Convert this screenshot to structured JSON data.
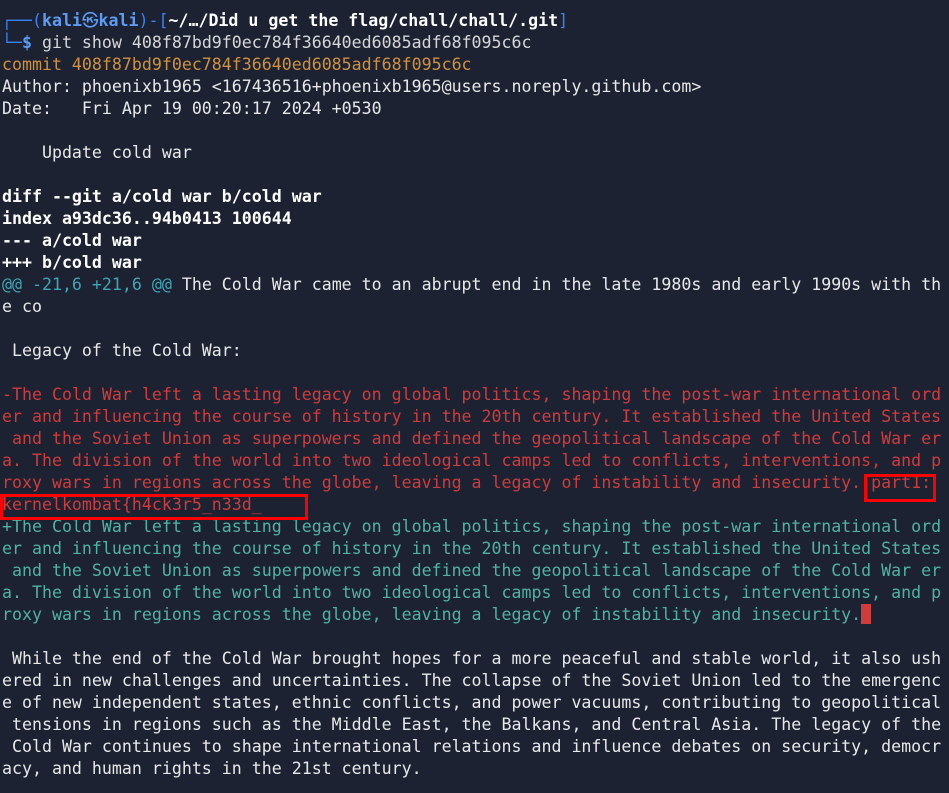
{
  "prompt": {
    "frame_open": "┌──(",
    "user": "kali",
    "at": "㉿",
    "host": "kali",
    "frame_mid": ")-[",
    "path": "~/…/Did u get the flag/chall/chall/.git",
    "frame_close": "]",
    "frame_bottom": "└─",
    "sigil": "$",
    "command": " git show 408f87bd9f0ec784f36640ed6085adf68f095c6c"
  },
  "commit": {
    "line": "commit 408f87bd9f0ec784f36640ed6085adf68f095c6c",
    "author": "Author: phoenixb1965 <167436516+phoenixb1965@users.noreply.github.com>",
    "date": "Date:   Fri Apr 19 00:20:17 2024 +0530",
    "message": "    Update cold war"
  },
  "diff": {
    "header": "diff --git a/cold war b/cold war",
    "index": "index a93dc36..94b0413 100644",
    "minus_file": "--- a/cold war",
    "plus_file": "+++ b/cold war",
    "hunk_marker": "@@ -21,6 +21,6 @@",
    "hunk_context_1": " The Cold War came to an abrupt end in the late 1980s and early 1990s with th",
    "hunk_context_2": "e co",
    "legacy_heading": " Legacy of the Cold War:",
    "removed_lines": [
      "-The Cold War left a lasting legacy on global politics, shaping the post-war international ord",
      "er and influencing the course of history in the 20th century. It established the United States",
      " and the Soviet Union as superpowers and defined the geopolitical landscape of the Cold War er",
      "a. The division of the world into two ideological camps led to conflicts, interventions, and p",
      "roxy wars in regions across the globe, leaving a legacy of instability and insecurity. part1:",
      "kernelkombat{h4ck3r5_n33d_"
    ],
    "added_lines": [
      "+The Cold War left a lasting legacy on global politics, shaping the post-war international ord",
      "er and influencing the course of history in the 20th century. It established the United States",
      " and the Soviet Union as superpowers and defined the geopolitical landscape of the Cold War er",
      "a. The division of the world into two ideological camps led to conflicts, interventions, and p",
      "roxy wars in regions across the globe, leaving a legacy of instability and insecurity."
    ],
    "context_lines": [
      " While the end of the Cold War brought hopes for a more peaceful and stable world, it also ush",
      "ered in new challenges and uncertainties. The collapse of the Soviet Union led to the emergenc",
      "e of new independent states, ethnic conflicts, and power vacuums, contributing to geopolitical",
      " tensions in regions such as the Middle East, the Balkans, and Central Asia. The legacy of the",
      " Cold War continues to shape international relations and influence debates on security, democr",
      "acy, and human rights in the 21st century."
    ]
  },
  "colors": {
    "background": "#1c2231",
    "prompt_blue": "#5c9cf5",
    "commit_orange": "#d1913c",
    "removed_red": "#d13b3b",
    "added_teal": "#4fb3a2",
    "highlight_box": "#ff0000"
  }
}
